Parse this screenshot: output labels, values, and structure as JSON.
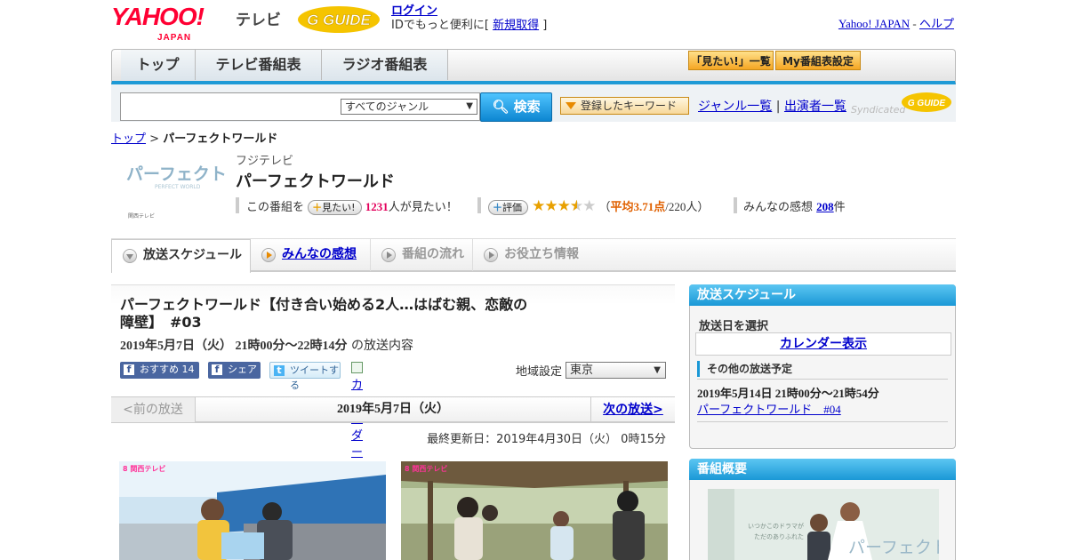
{
  "header": {
    "yahoo_logo": "YAHOO!",
    "yahoo_japan": "JAPAN",
    "tv_label": "テレビ",
    "gguide_logo": "G GUIDE",
    "login": "ログイン",
    "login_prefix": "IDでもっと便利に[",
    "signup": "新規取得",
    "login_suffix": "]",
    "yahoo_japan_link": "Yahoo! JAPAN",
    "separator": "-",
    "help": "ヘルプ"
  },
  "nav": {
    "tabs": [
      "トップ",
      "テレビ番組表",
      "ラジオ番組表"
    ],
    "mitai_list": "「見たい!」一覧",
    "my_schedule": "My番組表設定"
  },
  "search": {
    "genre": "すべてのジャンル",
    "button": "検索",
    "keyword_button": "登録したキーワード",
    "genre_list": "ジャンル一覧",
    "divider": "|",
    "performer_list": "出演者一覧",
    "syndicated": "Syndicated"
  },
  "breadcrumb": {
    "home": "トップ",
    "sep": ">",
    "current": "パーフェクトワールド"
  },
  "program": {
    "logo_text": "パーフェクト ワールド",
    "logo_sub": "PERFECT WORLD",
    "logo_ch": "関西テレビ",
    "channel": "フジテレビ",
    "title": "パーフェクトワールド",
    "mitai_prefix": "この番組を",
    "mitai_button": "見たい!",
    "mitai_count": "1231",
    "mitai_suffix": "人が見たい！",
    "rating_button": "評価",
    "rating_value": 3.71,
    "rating_open": "（",
    "rating_label": "平均3.71点",
    "rating_count": "/220人）",
    "impressions_prefix": "みんなの感想",
    "impressions_count": "208",
    "impressions_suffix": "件"
  },
  "tabs": [
    "放送スケジュール",
    "みんなの感想",
    "番組の流れ",
    "お役立ち情報"
  ],
  "episode": {
    "title": "パーフェクトワールド【付き合い始める2人…はばむ親、恋敵の障壁】　#03",
    "date": "2019年5月7日（火） 21時00分～22時14分",
    "date_suffix": "の放送内容",
    "fb_recommend": "おすすめ",
    "fb_count": "14",
    "fb_share": "シェア",
    "tweet": "ツイートする",
    "calendar_register": "カレンダーに登録",
    "region_label": "地域設定",
    "region_value": "東京"
  },
  "episode_nav": {
    "prev": "<前の放送",
    "current": "2019年5月7日（火）",
    "next": "次の放送>"
  },
  "updated": "最終更新日：2019年4月30日（火） 0時15分",
  "photos": {
    "tag1": "8 関西テレビ",
    "tag2": "8 関西テレビ"
  },
  "sidebar": {
    "schedule_title": "放送スケジュール",
    "select_date": "放送日を選択",
    "calendar": "カレンダー表示",
    "other_schedule": "その他の放送予定",
    "other_date": "2019年5月14日 21時00分～21時54分",
    "other_link": "パーフェクトワールド　#04",
    "summary_title": "番組概要",
    "summary_img_text": "パーフェクト"
  },
  "colors": {
    "accent_blue": "#1a98d6",
    "yahoo_red": "#ff0033",
    "gold": "#e8a000",
    "link": "#0000cc"
  }
}
